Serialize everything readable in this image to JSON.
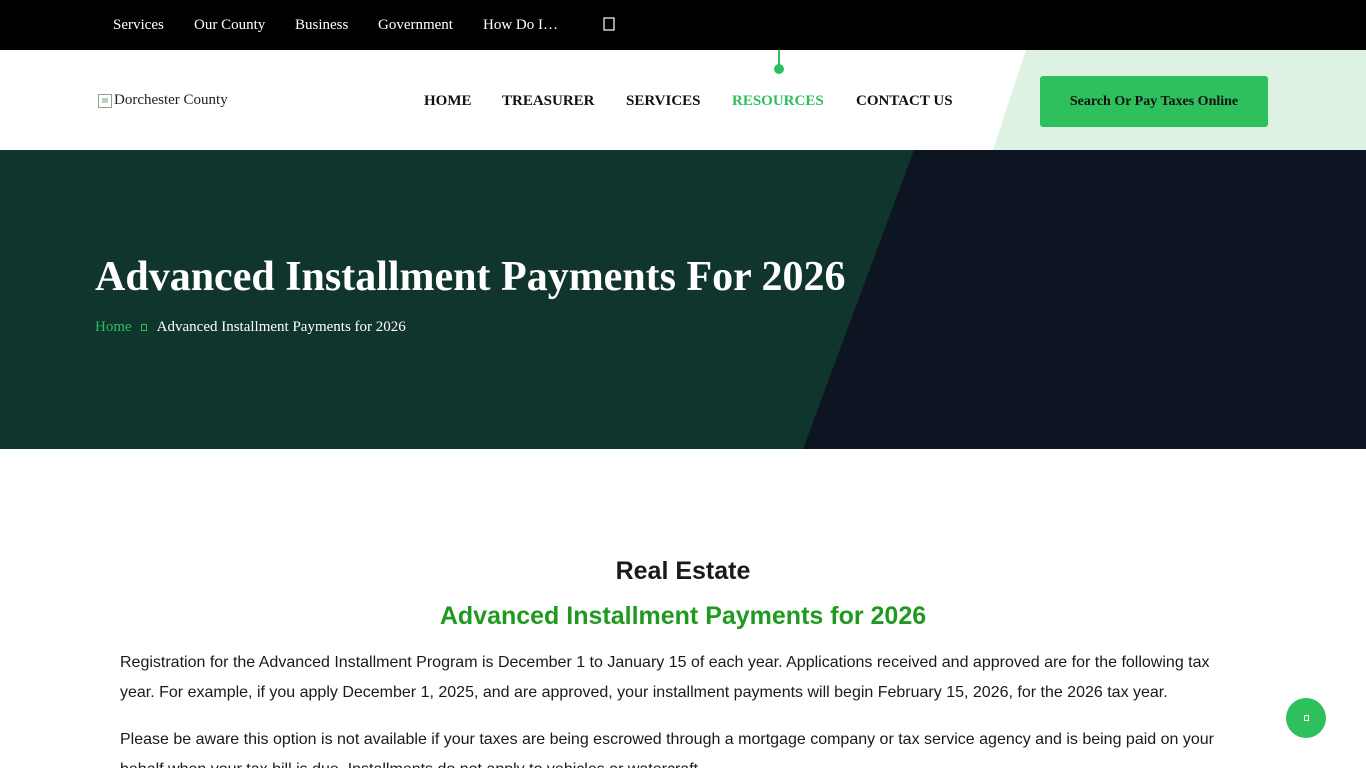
{
  "topbar": {
    "links": [
      "Services",
      "Our County",
      "Business",
      "Government",
      "How Do I…"
    ],
    "search_icon": "search-icon"
  },
  "header": {
    "logo_alt": "Dorchester County",
    "nav": [
      "HOME",
      "TREASURER",
      "SERVICES",
      "RESOURCES",
      "CONTACT US"
    ],
    "active_nav": "RESOURCES",
    "cta_label": "Search Or Pay Taxes Online"
  },
  "hero": {
    "title": "Advanced Installment Payments For 2026",
    "breadcrumb": {
      "home": "Home",
      "separator_icon": "chevron-right-icon",
      "current": "Advanced Installment Payments for 2026"
    }
  },
  "content": {
    "heading": "Real Estate",
    "subheading": "Advanced Installment Payments for 2026",
    "paragraphs": [
      "Registration for the Advanced Installment Program is December 1 to January 15 of each year. Applications received and approved are for the following tax year. For example, if you apply December 1, 2025, and are approved, your installment payments will begin February 15, 2026, for the 2026 tax year.",
      "Please be aware this option is not available if your taxes are being escrowed through a mortgage company or tax service agency and is being paid on your behalf when your tax bill is due. Installments do not apply to vehicles or watercraft."
    ]
  },
  "fab_icon": "arrow-up-icon",
  "colors": {
    "accent": "#2ec05c",
    "hero_green": "#0f352c",
    "hero_navy": "#0d1422",
    "subheading_green": "#1f9a1f",
    "topbar": "#000000"
  }
}
